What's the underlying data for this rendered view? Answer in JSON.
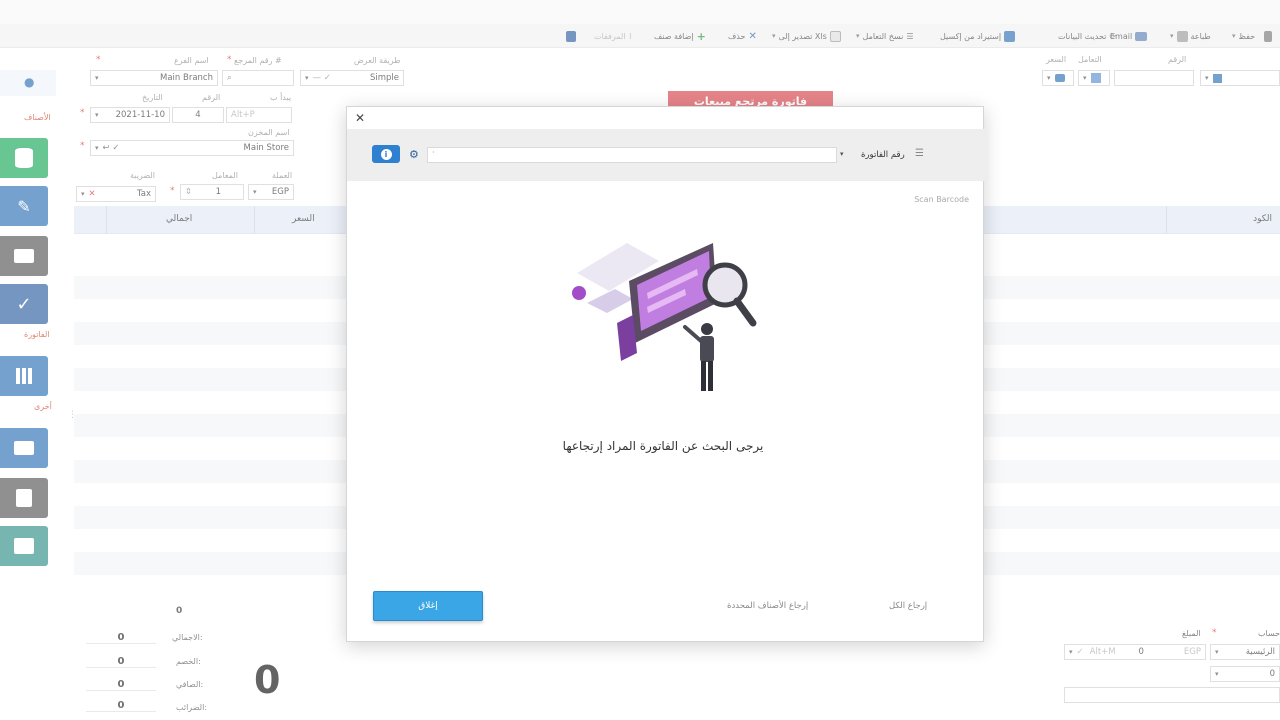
{
  "toolbar": {
    "save": "حفظ",
    "print": "طباعة",
    "email": "Email",
    "update_data": "تحديث البيانات",
    "import_excel": "إستيراد من إكسيل",
    "copy_transaction": "نسخ التعامل",
    "export_xls": "تصدير إلى Xls",
    "delete": "حذف",
    "add_item": "إضافة صنف",
    "attachments": "المرفقات"
  },
  "header": {
    "number_label": "الرقم",
    "dealer_label": "التعامل",
    "price_label": "السعر",
    "display_method_label": "طريقة العرض",
    "display_method_value": "Simple",
    "reference_number_label": "رقم المرجع #",
    "branch_name_label": "اسم الفرع",
    "branch_name_value": "Main Branch",
    "starts_with_label": "يبدأ ب",
    "number2_label": "الرقم",
    "number2_value": "4",
    "number_placeholder": "Alt+P",
    "date_label": "التاريخ",
    "date_value": "2021-11-10",
    "store_name_label": "اسم المخزن",
    "store_name_value": "Main Store",
    "currency_label": "العملة",
    "currency_value": "EGP",
    "rate_label": "المعامل",
    "rate_value": "1",
    "tax_label": "الضريبة",
    "tax_value": "Tax",
    "banner_text": "فاتورة مرتجع مبيعات"
  },
  "sidebar": {
    "items_section": "الأصناف",
    "invoice_section": "الفاتورة",
    "other_section": "أخرى",
    "colors": {
      "green": "#17a85a",
      "blue": "#2b6fb5",
      "dark": "#3a3a3a"
    }
  },
  "grid": {
    "col_code": "الكود",
    "col_price": "السعر",
    "col_total": "اجمالي"
  },
  "totals": {
    "count_value": "0",
    "total_label": "الاجمالي:",
    "total_value": "0",
    "discount_label": "الخصم:",
    "discount_value": "0",
    "net_label": "الصافي:",
    "net_value": "0",
    "tax_label": "الضرائب:",
    "tax_value": "0",
    "big_value": "0"
  },
  "payment": {
    "account_label": "حساب",
    "amount_label": "المبلغ",
    "account_value": "الرئيسية",
    "currency": "EGP",
    "amount_value": "0",
    "amount_placeholder": "Alt+M",
    "second_value": "0"
  },
  "modal": {
    "search_field_label": "رقم الفاتورة",
    "scan_barcode": "Scan Barcode",
    "message": "يرجى البحث عن الفاتورة المراد إرتجاعها",
    "ok_button": "إغلاق",
    "return_selected": "إرجاع الأصناف المحددة",
    "return_all": "إرجاع الكل"
  }
}
